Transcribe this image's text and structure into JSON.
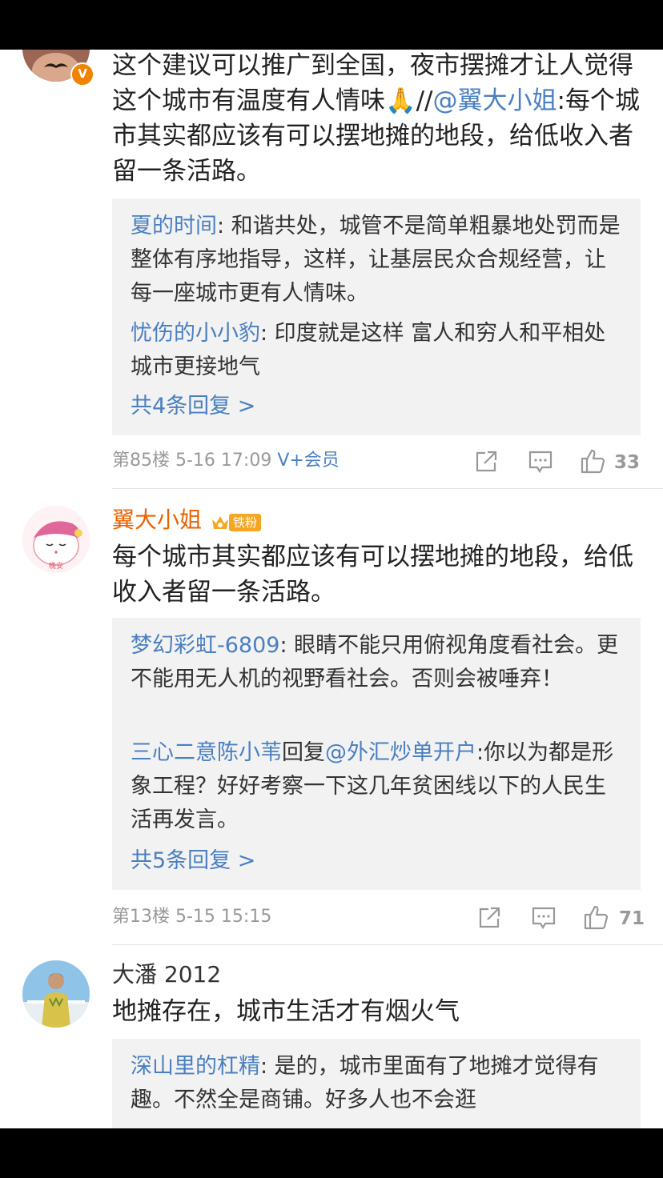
{
  "comments": [
    {
      "text_main": "这个建议可以推广到全国，夜市摆摊才让人觉得这个城市有温度有人情味🙏//",
      "text_at": "@翼大小姐",
      "text_tail": ":每个城市其实都应该有可以摆地摊的地段，给低收入者留一条活路。",
      "replies": [
        {
          "name": "夏的时间",
          "text": ": 和谐共处，城管不是简单粗暴地处罚而是整体有序地指导，这样，让基层民众合规经营，让每一座城市更有人情味。"
        },
        {
          "name": "忧伤的小小豹",
          "text": ": 印度就是这样  富人和穷人和平相处  城市更接地气"
        }
      ],
      "more_replies": "共4条回复 >",
      "floor": "第85楼",
      "time": "5-16 17:09",
      "vip": "V+会员",
      "likes": "33"
    },
    {
      "username": "翼大小姐",
      "badge": "铁粉",
      "text": "每个城市其实都应该有可以摆地摊的地段，给低收入者留一条活路。",
      "replies": [
        {
          "name": "梦幻彩虹-6809",
          "text": ": 眼睛不能只用俯视角度看社会。更不能用无人机的视野看社会。否则会被唾弃！"
        },
        {
          "name": "三心二意陈小苇",
          "mid": "回复",
          "at": "@外汇炒单开户",
          "text": ":你以为都是形象工程？好好考察一下这几年贫困线以下的人民生活再发言。"
        }
      ],
      "more_replies": "共5条回复 >",
      "floor": "第13楼",
      "time": "5-15 15:15",
      "likes": "71"
    },
    {
      "username": "大潘 2012",
      "text": "地摊存在，城市生活才有烟火气",
      "replies": [
        {
          "name": "深山里的杠精",
          "text": ": 是的，城市里面有了地摊才觉得有趣。不然全是商铺。好多人也不会逛"
        }
      ]
    }
  ],
  "colors": {
    "link": "#4a7fc1",
    "vip_name": "#eb6100",
    "reply_bg": "#f2f2f2",
    "meta": "#999999"
  }
}
